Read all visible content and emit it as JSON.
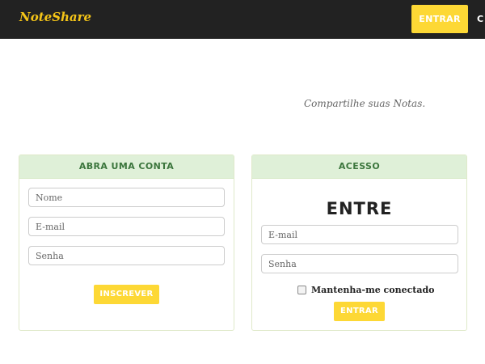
{
  "navbar": {
    "brand": "NoteShare",
    "entrar_label": "ENTRAR",
    "cut_label": "C"
  },
  "hero": {
    "tagline": "Compartilhe suas Notas."
  },
  "signup": {
    "title": "ABRA UMA CONTA",
    "name_placeholder": "Nome",
    "email_placeholder": "E-mail",
    "password_placeholder": "Senha",
    "submit_label": "INSCREVER"
  },
  "login": {
    "title": "ACESSO",
    "heading": "ENTRE",
    "email_placeholder": "E-mail",
    "password_placeholder": "Senha",
    "remember_label": "Mantenha-me conectado",
    "remember_checked": false,
    "submit_label": "ENTRAR"
  },
  "colors": {
    "navbar_bg": "#222222",
    "brand": "#f5c518",
    "accent_button": "#fdd835",
    "panel_header_bg": "#dff0d8",
    "panel_header_text": "#3c763d"
  }
}
